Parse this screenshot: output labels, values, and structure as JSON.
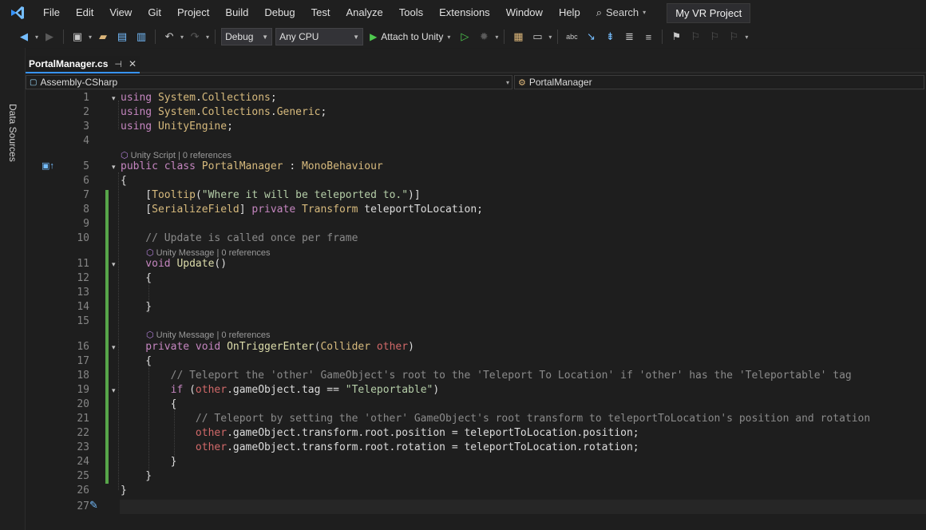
{
  "menubar": {
    "items": [
      "File",
      "Edit",
      "View",
      "Git",
      "Project",
      "Build",
      "Debug",
      "Test",
      "Analyze",
      "Tools",
      "Extensions",
      "Window",
      "Help"
    ],
    "search_label": "Search",
    "project_title": "My VR Project"
  },
  "toolbar": {
    "config": "Debug",
    "platform": "Any CPU",
    "run_label": "Attach to Unity"
  },
  "side_panel": {
    "label": "Data Sources"
  },
  "tab": {
    "name": "PortalManager.cs"
  },
  "navbar": {
    "left": "Assembly-CSharp",
    "right": "PortalManager"
  },
  "codelens": {
    "class": "Unity Script | 0 references",
    "update": "Unity Message | 0 references",
    "trigger": "Unity Message | 0 references"
  },
  "lines": [
    {
      "n": "1",
      "t": [
        [
          "kw",
          "using "
        ],
        [
          "ns",
          "System"
        ],
        [
          "plain",
          "."
        ],
        [
          "ns",
          "Collections"
        ],
        [
          "plain",
          ";"
        ]
      ]
    },
    {
      "n": "2",
      "t": [
        [
          "kw",
          "using "
        ],
        [
          "ns",
          "System"
        ],
        [
          "plain",
          "."
        ],
        [
          "ns",
          "Collections"
        ],
        [
          "plain",
          "."
        ],
        [
          "ns",
          "Generic"
        ],
        [
          "plain",
          ";"
        ]
      ]
    },
    {
      "n": "3",
      "t": [
        [
          "kw",
          "using "
        ],
        [
          "ns",
          "UnityEngine"
        ],
        [
          "plain",
          ";"
        ]
      ]
    },
    {
      "n": "4",
      "t": []
    },
    {
      "n": "5",
      "t": [
        [
          "kw",
          "public class "
        ],
        [
          "type",
          "PortalManager"
        ],
        [
          "plain",
          " : "
        ],
        [
          "type",
          "MonoBehaviour"
        ]
      ]
    },
    {
      "n": "6",
      "t": [
        [
          "plain",
          "{"
        ]
      ]
    },
    {
      "n": "7",
      "t": [
        [
          "plain",
          "    ["
        ],
        [
          "type",
          "Tooltip"
        ],
        [
          "plain",
          "("
        ],
        [
          "str",
          "\"Where it will be teleported to.\""
        ],
        [
          "plain",
          ")]"
        ]
      ]
    },
    {
      "n": "8",
      "t": [
        [
          "plain",
          "    ["
        ],
        [
          "type",
          "SerializeField"
        ],
        [
          "plain",
          "] "
        ],
        [
          "kw",
          "private "
        ],
        [
          "type",
          "Transform"
        ],
        [
          "plain",
          " teleportToLocation;"
        ]
      ]
    },
    {
      "n": "9",
      "t": []
    },
    {
      "n": "10",
      "t": [
        [
          "cm",
          "    // Update is called once per frame"
        ]
      ]
    },
    {
      "n": "11",
      "t": [
        [
          "kw",
          "    void "
        ],
        [
          "fn",
          "Update"
        ],
        [
          "plain",
          "()"
        ]
      ]
    },
    {
      "n": "12",
      "t": [
        [
          "plain",
          "    {"
        ]
      ]
    },
    {
      "n": "13",
      "t": []
    },
    {
      "n": "14",
      "t": [
        [
          "plain",
          "    }"
        ]
      ]
    },
    {
      "n": "15",
      "t": []
    },
    {
      "n": "16",
      "t": [
        [
          "kw",
          "    private void "
        ],
        [
          "fn",
          "OnTriggerEnter"
        ],
        [
          "plain",
          "("
        ],
        [
          "type",
          "Collider"
        ],
        [
          "plain",
          " "
        ],
        [
          "var",
          "other"
        ],
        [
          "plain",
          ")"
        ]
      ]
    },
    {
      "n": "17",
      "t": [
        [
          "plain",
          "    {"
        ]
      ]
    },
    {
      "n": "18",
      "t": [
        [
          "cm",
          "        // Teleport the 'other' GameObject's root to the 'Teleport To Location' if 'other' has the 'Teleportable' tag"
        ]
      ]
    },
    {
      "n": "19",
      "t": [
        [
          "kw",
          "        if "
        ],
        [
          "plain",
          "("
        ],
        [
          "var",
          "other"
        ],
        [
          "plain",
          ".gameObject.tag == "
        ],
        [
          "str",
          "\"Teleportable\""
        ],
        [
          "plain",
          ")"
        ]
      ]
    },
    {
      "n": "20",
      "t": [
        [
          "plain",
          "        {"
        ]
      ]
    },
    {
      "n": "21",
      "t": [
        [
          "cm",
          "            // Teleport by setting the 'other' GameObject's root transform to teleportToLocation's position and rotation"
        ]
      ]
    },
    {
      "n": "22",
      "t": [
        [
          "plain",
          "            "
        ],
        [
          "var",
          "other"
        ],
        [
          "plain",
          ".gameObject.transform.root.position = teleportToLocation.position;"
        ]
      ]
    },
    {
      "n": "23",
      "t": [
        [
          "plain",
          "            "
        ],
        [
          "var",
          "other"
        ],
        [
          "plain",
          ".gameObject.transform.root.rotation = teleportToLocation.rotation;"
        ]
      ]
    },
    {
      "n": "24",
      "t": [
        [
          "plain",
          "        }"
        ]
      ]
    },
    {
      "n": "25",
      "t": [
        [
          "plain",
          "    }"
        ]
      ]
    },
    {
      "n": "26",
      "t": [
        [
          "plain",
          "}"
        ]
      ]
    },
    {
      "n": "27",
      "t": []
    }
  ]
}
